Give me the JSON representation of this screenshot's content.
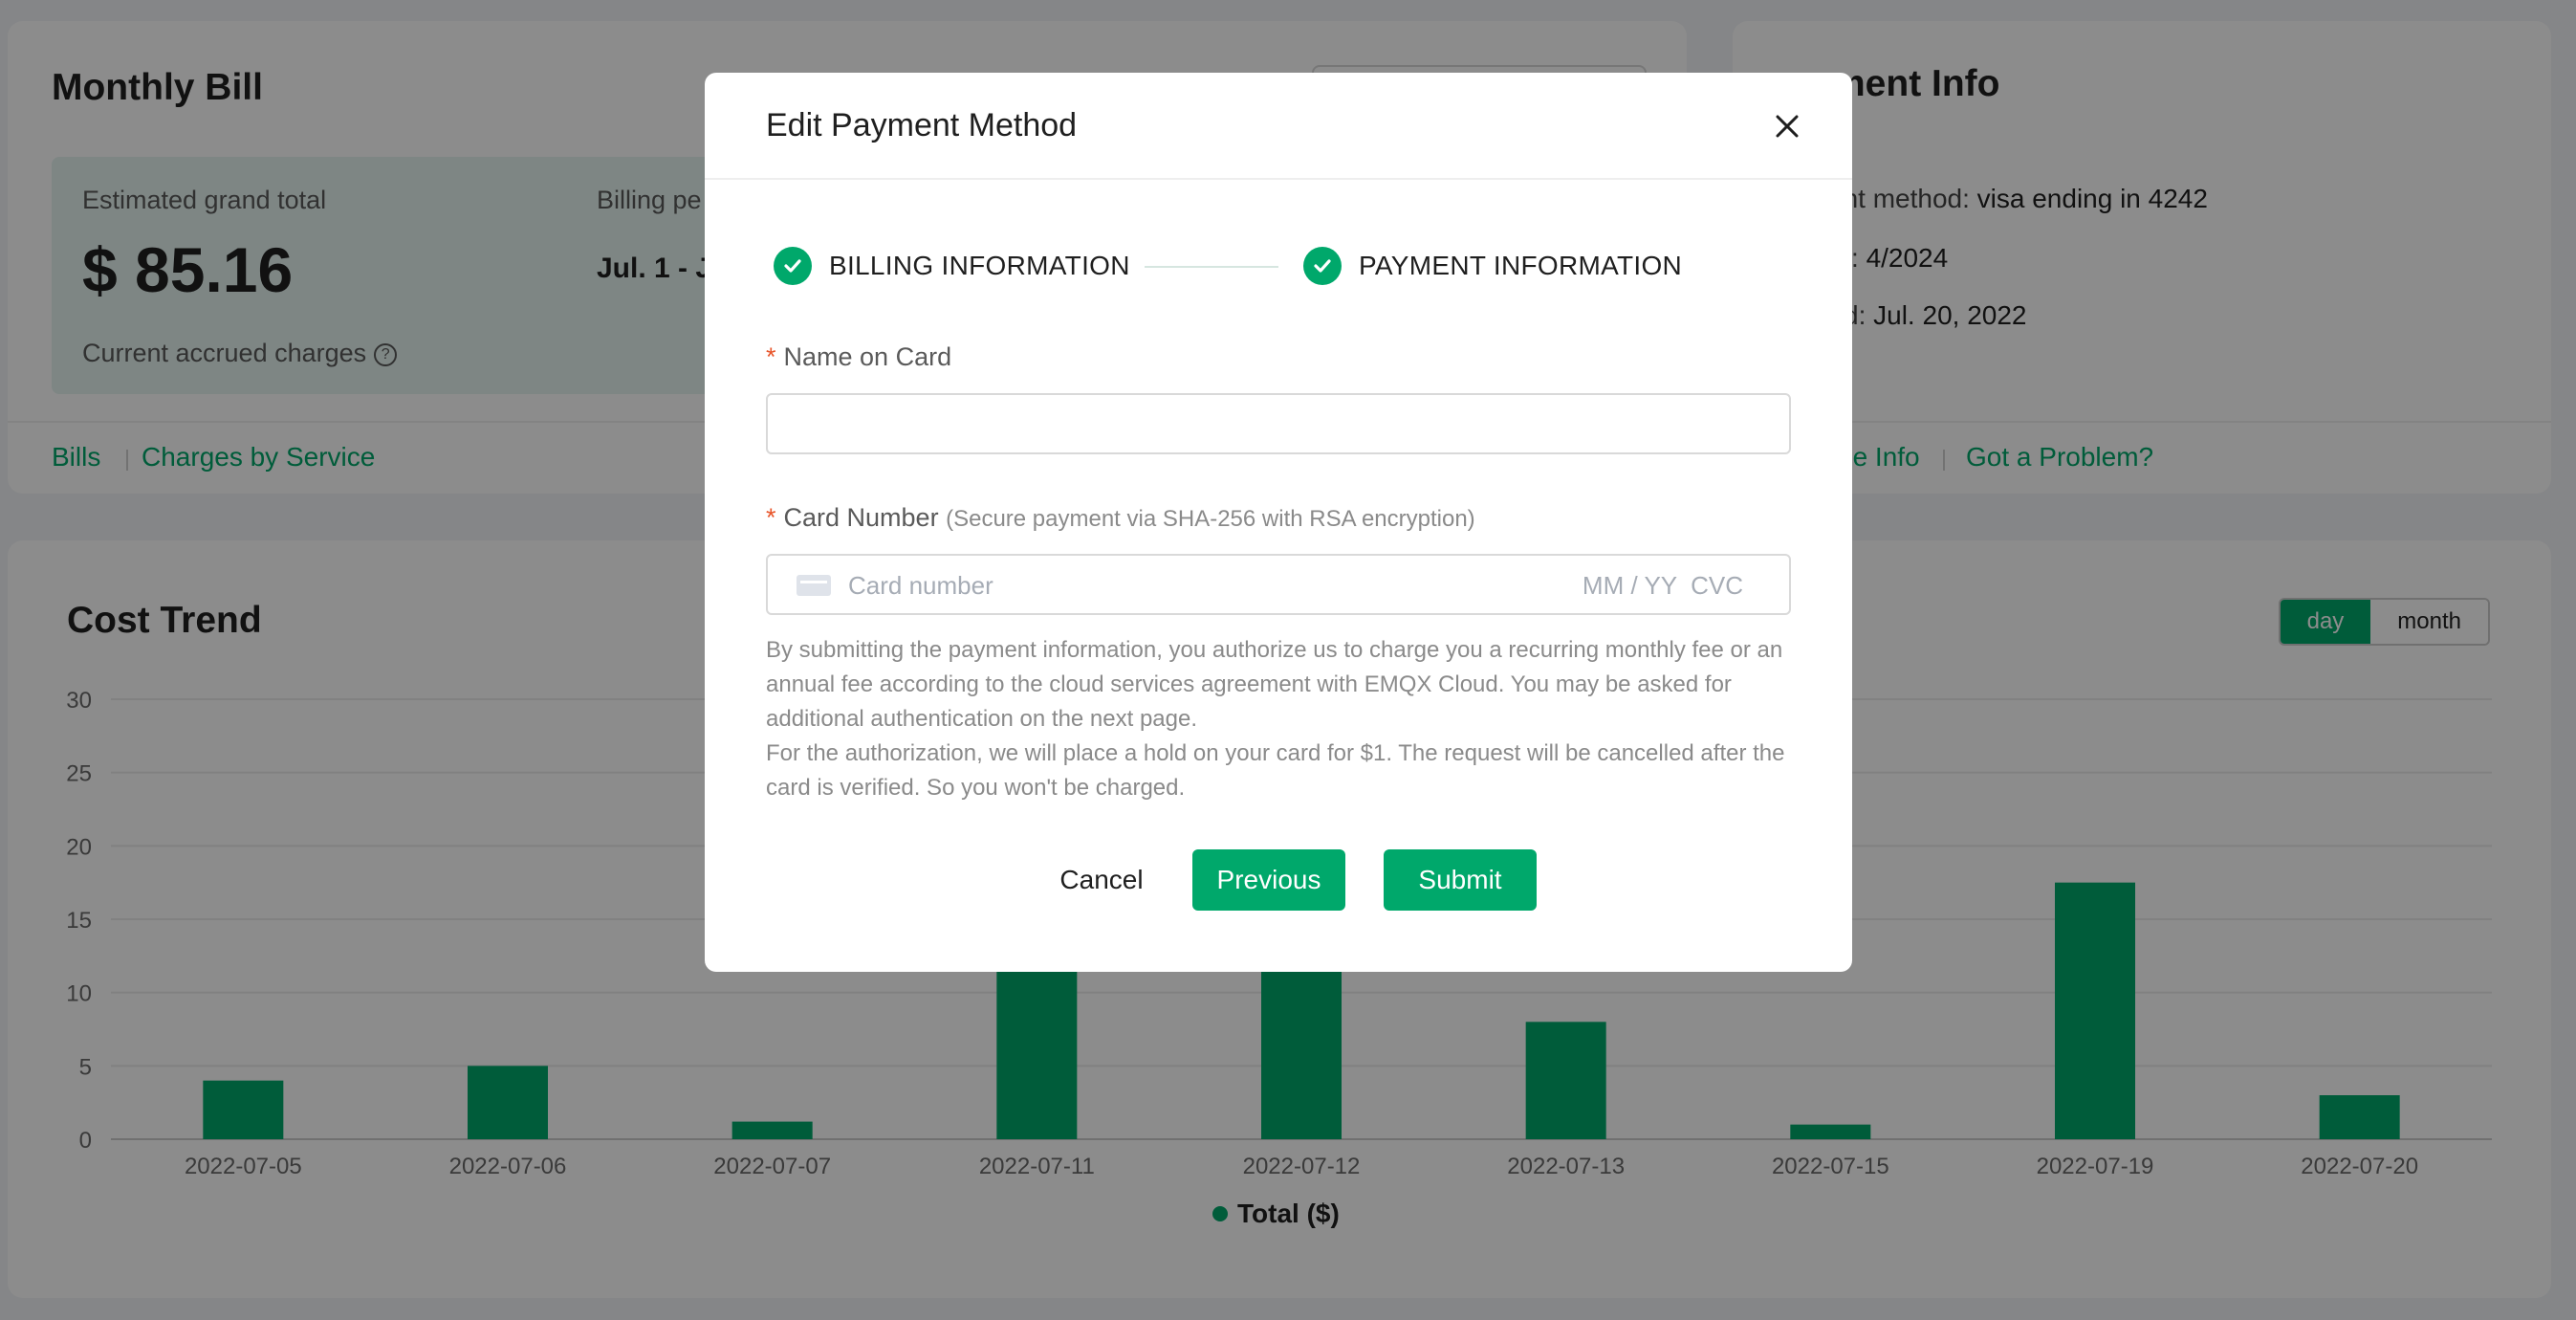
{
  "monthly_bill": {
    "title": "Monthly Bill",
    "estimated_label": "Estimated grand total",
    "amount": "$ 85.16",
    "accrued_label": "Current accrued charges",
    "period_label": "Billing pe",
    "period_value": "Jul. 1 - J",
    "links": [
      "Bills",
      "Charges by Service"
    ]
  },
  "payment_info": {
    "title": "ment Info",
    "method_label": "ent method: ",
    "method_value": "visa ending in 4242",
    "expires_label": "s: ",
    "expires_value": "4/2024",
    "date_label": "d: ",
    "date_value": "Jul. 20, 2022",
    "links": [
      "ge Info",
      "Got a Problem?"
    ]
  },
  "cost_trend": {
    "title": "Cost Trend",
    "toggle": [
      "day",
      "month"
    ],
    "active_toggle": "day"
  },
  "chart_data": {
    "type": "bar",
    "categories": [
      "2022-07-05",
      "2022-07-06",
      "2022-07-07",
      "2022-07-11",
      "2022-07-12",
      "2022-07-13",
      "2022-07-15",
      "2022-07-19",
      "2022-07-20"
    ],
    "series": [
      {
        "name": "Total ($)",
        "values": [
          4,
          5,
          1.2,
          26,
          26,
          8,
          1,
          17.5,
          3
        ]
      }
    ],
    "yticks": [
      0,
      5,
      10,
      15,
      20,
      25,
      30
    ],
    "ylim": [
      0,
      30
    ],
    "grid": true,
    "legend": "bottom-center",
    "color": "#00a86b"
  },
  "modal": {
    "title": "Edit Payment Method",
    "steps": [
      "BILLING INFORMATION",
      "PAYMENT INFORMATION"
    ],
    "name_label": "Name on Card",
    "name_value": "",
    "card_label": "Card Number",
    "card_hint": "(Secure payment via SHA-256 with RSA encryption)",
    "card_placeholder": "Card number",
    "card_exp_placeholder": "MM / YY  CVC",
    "notice_1": "By submitting the payment information, you authorize us to charge you a recurring monthly fee or an annual fee according to the cloud services agreement with EMQX Cloud. You may be asked for additional authentication on the next page.",
    "notice_2": "For the authorization, we will place a hold on your card for $1. The request will be cancelled after the card is verified. So you won't be charged.",
    "cancel": "Cancel",
    "previous": "Previous",
    "submit": "Submit"
  },
  "colors": {
    "accent": "#00a86b",
    "required": "#e8552a"
  },
  "icons": [
    "help-circle-icon",
    "close-icon",
    "check-circle-icon",
    "credit-card-icon"
  ]
}
